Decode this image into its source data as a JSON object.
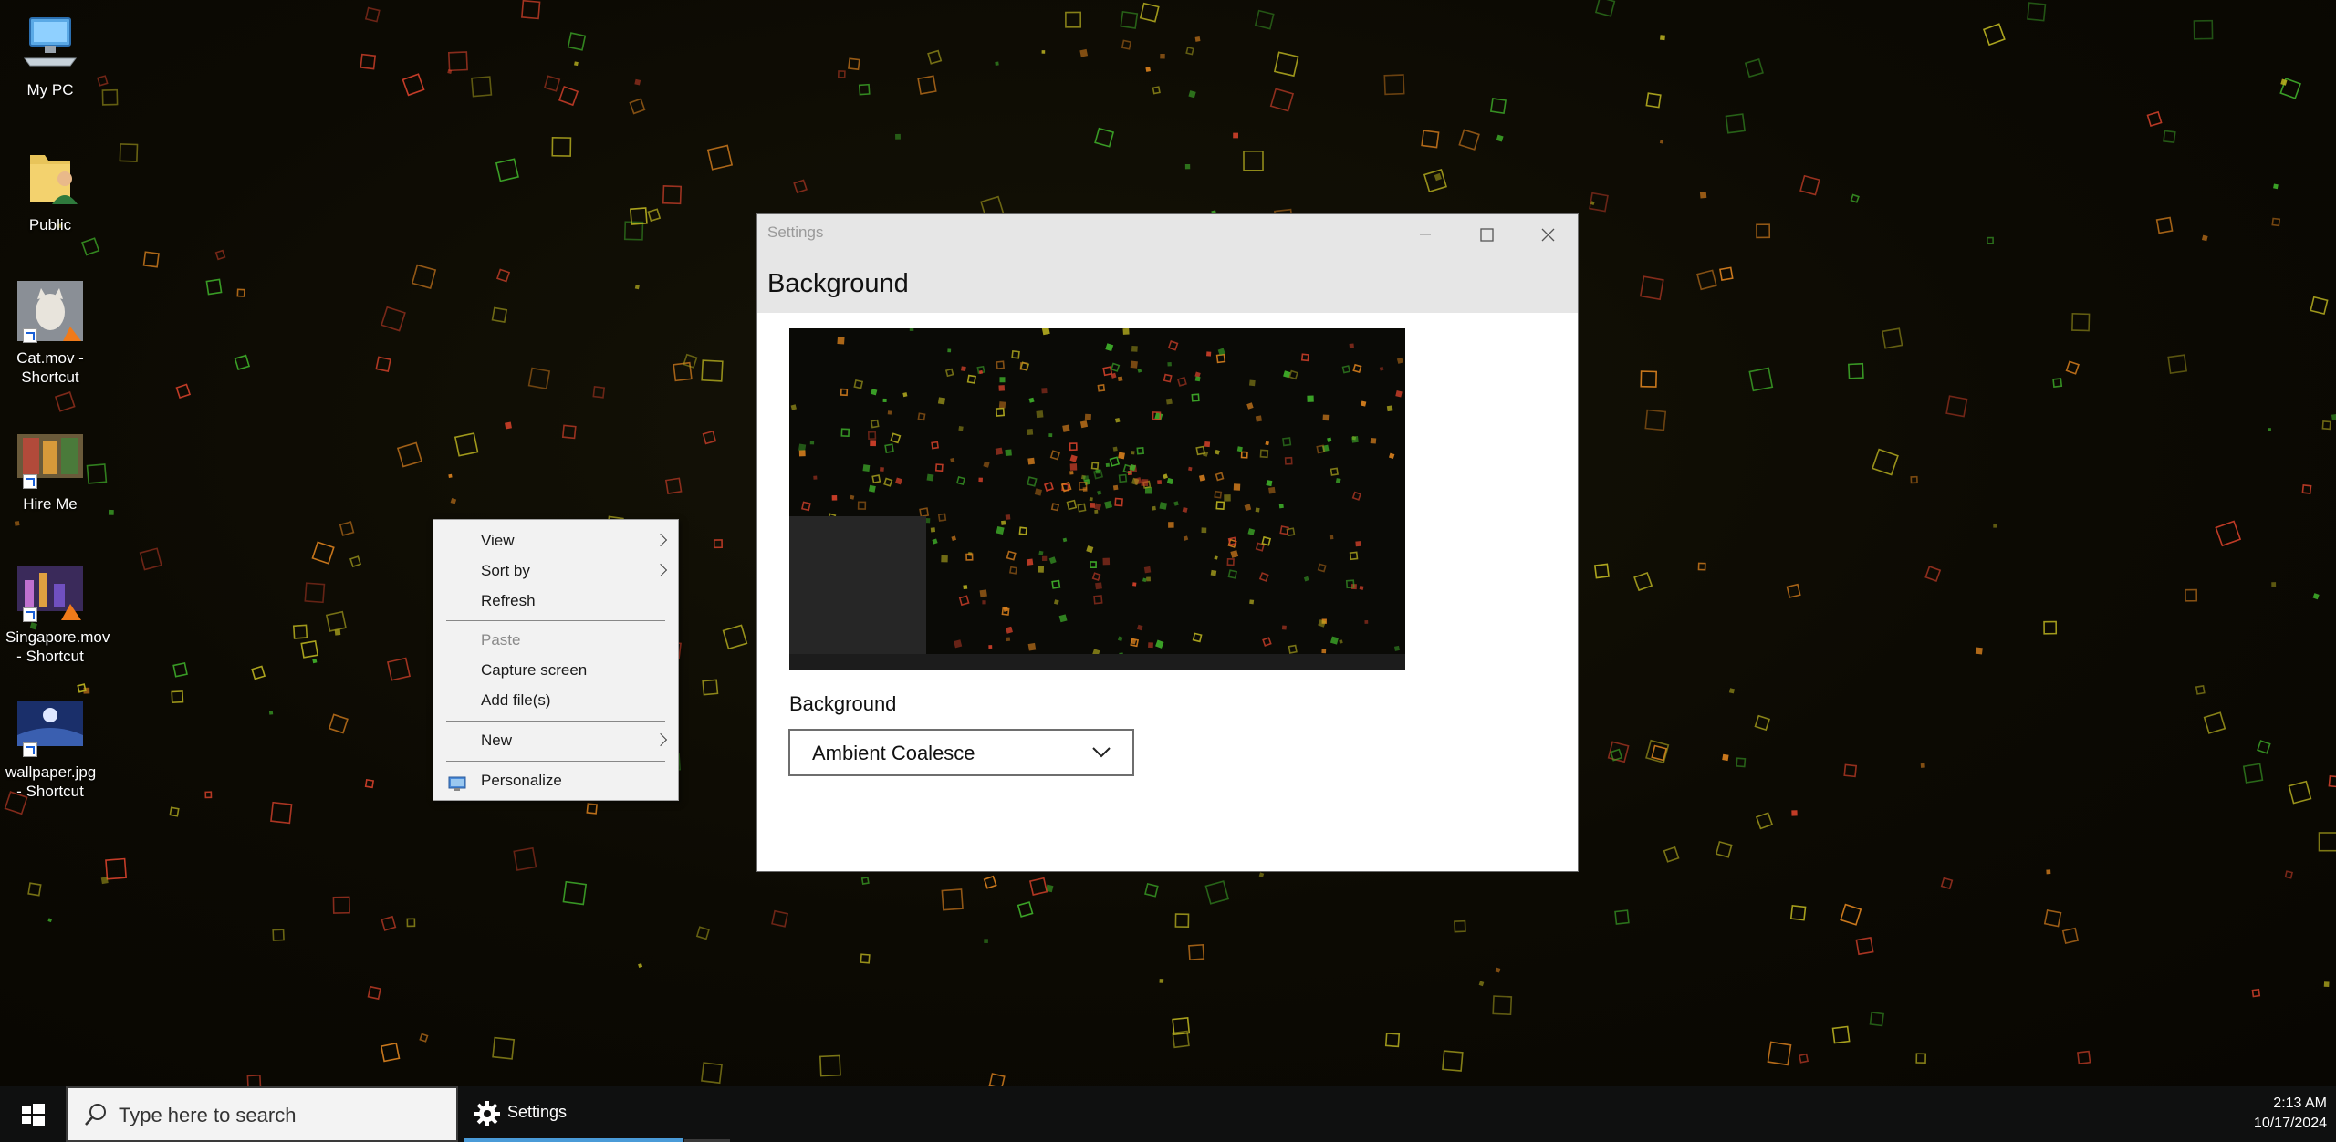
{
  "desktop": {
    "icons": [
      {
        "label": "My PC",
        "icon": "computer-icon"
      },
      {
        "label": "Public",
        "icon": "user-folder-icon"
      },
      {
        "label": "Cat.mov - Shortcut",
        "icon": "video-shortcut-icon"
      },
      {
        "label": "Hire Me",
        "icon": "image-shortcut-icon"
      },
      {
        "label": "Singapore.mov - Shortcut",
        "icon": "video-shortcut-icon"
      },
      {
        "label": "wallpaper.jpg - Shortcut",
        "icon": "image-shortcut-icon"
      }
    ]
  },
  "context_menu": {
    "view": "View",
    "sort_by": "Sort by",
    "refresh": "Refresh",
    "paste": "Paste",
    "capture_screen": "Capture screen",
    "add_files": "Add file(s)",
    "new": "New",
    "personalize": "Personalize"
  },
  "settings_window": {
    "title": "Settings",
    "header": "Background",
    "background_label": "Background",
    "background_value": "Ambient Coalesce"
  },
  "taskbar": {
    "search_placeholder": "Type here to search",
    "running_app": "Settings",
    "time": "2:13 AM",
    "date": "10/17/2024"
  },
  "colors": {
    "accent": "#4a9bd8",
    "particle_green": "#3fae2a",
    "particle_red": "#d0402a",
    "particle_orange": "#d8801e",
    "particle_yellow": "#b8b020"
  }
}
